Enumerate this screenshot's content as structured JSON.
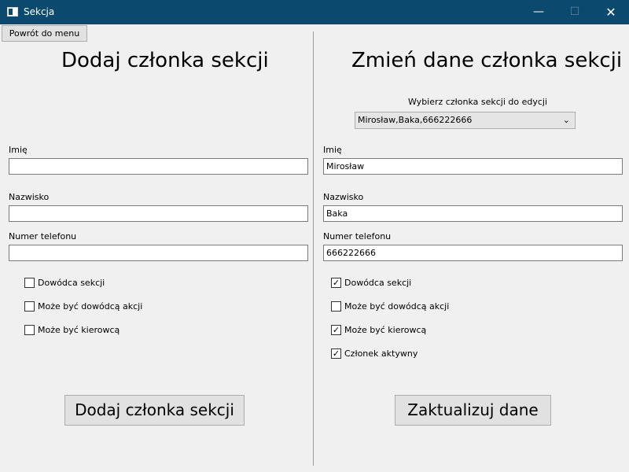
{
  "window": {
    "title": "Sekcja",
    "minimize_glyph": "—",
    "maximize_glyph": "☐",
    "close_glyph": "✕"
  },
  "back_button": "Powrót do menu",
  "add_panel": {
    "heading": "Dodaj członka sekcji",
    "first_name_label": "Imię",
    "first_name_value": "",
    "last_name_label": "Nazwisko",
    "last_name_value": "",
    "phone_label": "Numer telefonu",
    "phone_value": "",
    "checkboxes": [
      {
        "label": "Dowódca sekcji",
        "checked": false
      },
      {
        "label": "Może być dowódcą akcji",
        "checked": false
      },
      {
        "label": "Może być kierowcą",
        "checked": false
      }
    ],
    "submit_label": "Dodaj członka sekcji"
  },
  "edit_panel": {
    "heading": "Zmień dane członka sekcji",
    "select_label": "Wybierz członka sekcji do edycji",
    "select_value": "Mirosław,Baka,666222666",
    "first_name_label": "Imię",
    "first_name_value": "Mirosław",
    "last_name_label": "Nazwisko",
    "last_name_value": "Baka",
    "phone_label": "Numer telefonu",
    "phone_value": "666222666",
    "checkboxes": [
      {
        "label": "Dowódca sekcji",
        "checked": true
      },
      {
        "label": "Może być dowódcą akcji",
        "checked": false
      },
      {
        "label": "Może być kierowcą",
        "checked": true
      },
      {
        "label": "Członek aktywny",
        "checked": true
      }
    ],
    "submit_label": "Zaktualizuj dane"
  },
  "colors": {
    "titlebar": "#0b4a6e",
    "window_bg": "#f0f0f0",
    "button_bg": "#e1e1e1"
  }
}
